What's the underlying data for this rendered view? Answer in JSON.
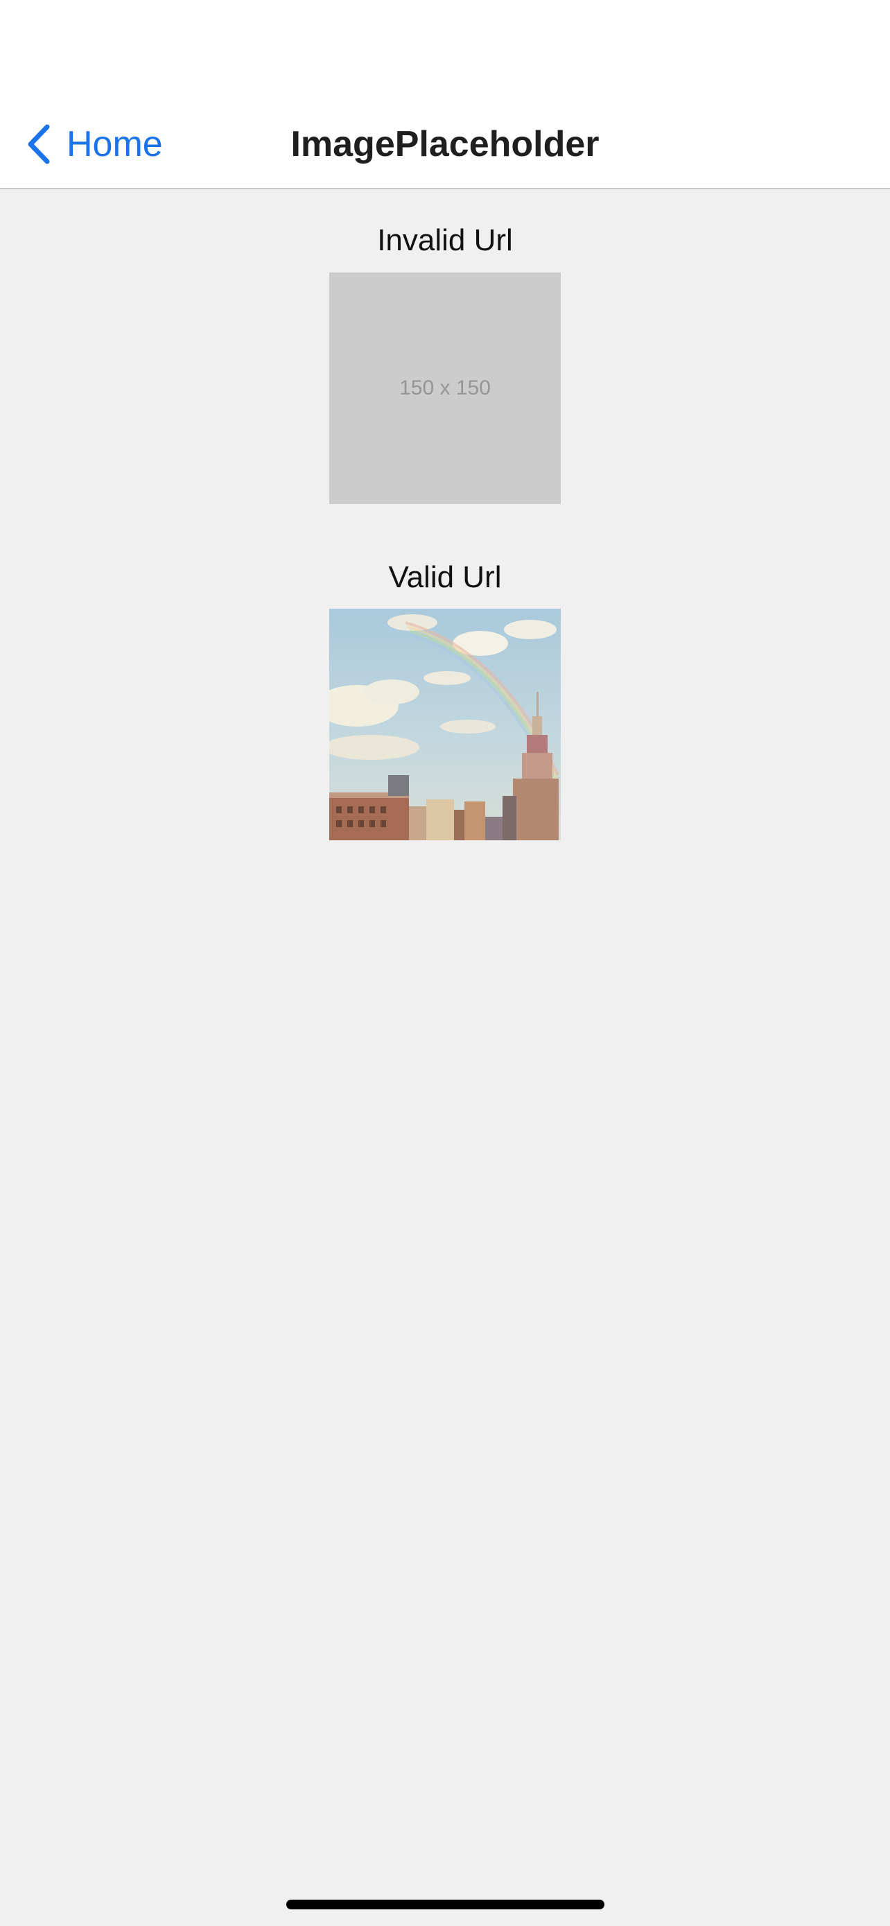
{
  "navbar": {
    "back_label": "Home",
    "back_icon": "chevron-left-icon",
    "title": "ImagePlaceholder",
    "accent_color": "#1a73e8"
  },
  "sections": {
    "invalid": {
      "label": "Invalid Url",
      "placeholder_text": "150 x 150"
    },
    "valid": {
      "label": "Valid Url"
    }
  }
}
